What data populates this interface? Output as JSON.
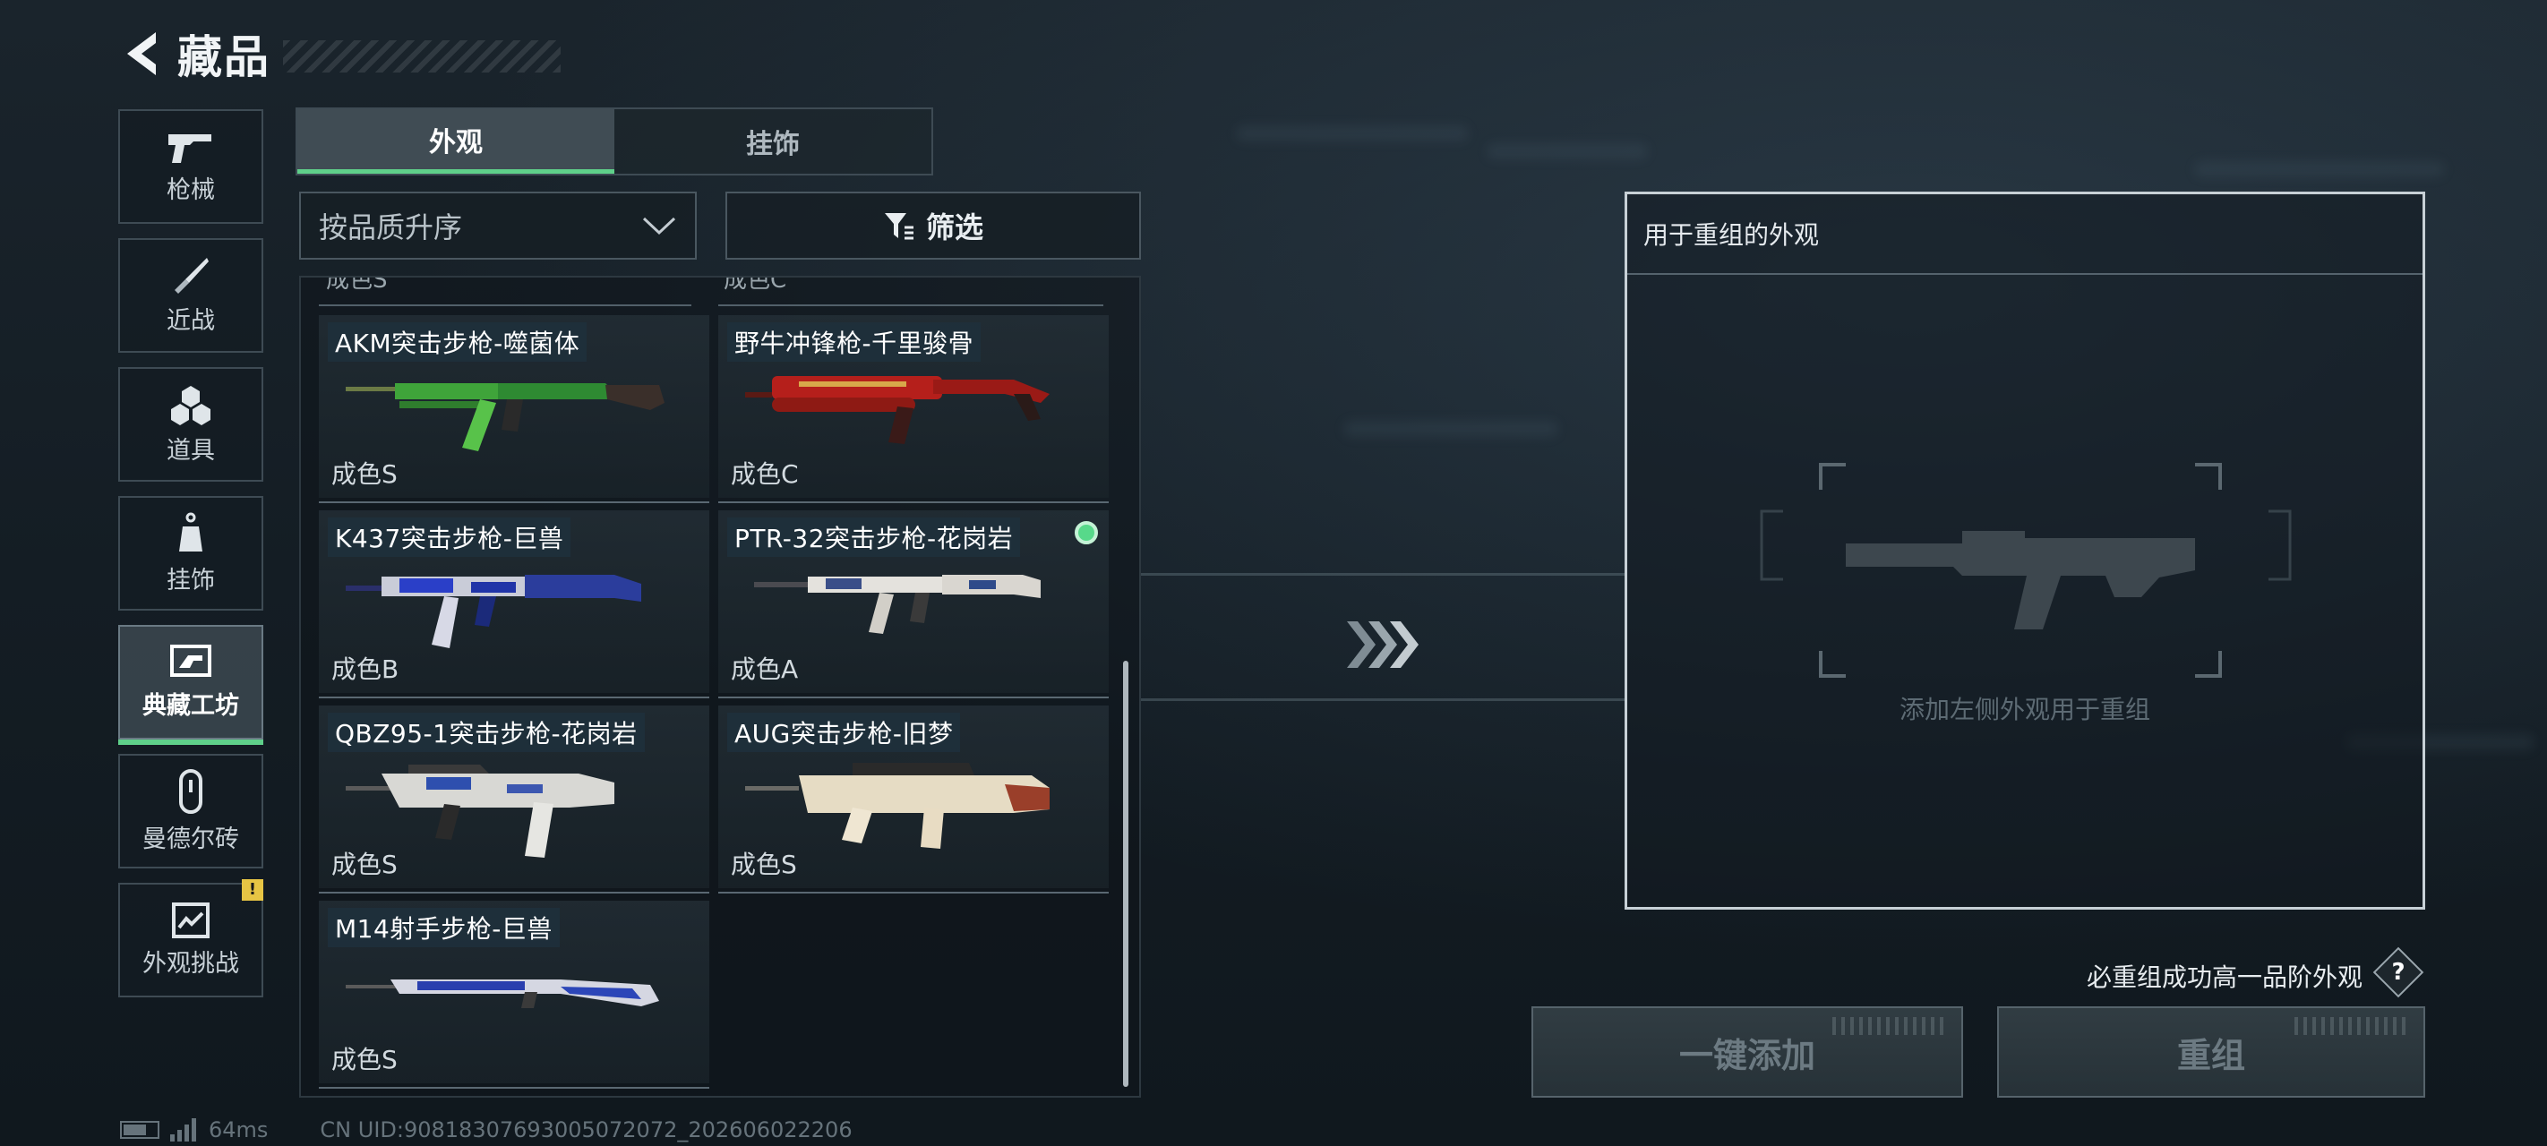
{
  "header": {
    "title": "藏品"
  },
  "sidebar": {
    "items": [
      {
        "label": "枪械",
        "icon": "pistol-icon",
        "active": false
      },
      {
        "label": "近战",
        "icon": "knife-icon",
        "active": false
      },
      {
        "label": "道具",
        "icon": "grenades-icon",
        "active": false
      },
      {
        "label": "挂饰",
        "icon": "charm-icon",
        "active": false
      },
      {
        "label": "典藏工坊",
        "icon": "workshop-icon",
        "active": true
      },
      {
        "label": "曼德尔砖",
        "icon": "mandel-brick-icon",
        "active": false
      },
      {
        "label": "外观挑战",
        "icon": "challenge-icon",
        "active": false,
        "badge": "!"
      }
    ]
  },
  "tabs": [
    {
      "label": "外观",
      "active": true
    },
    {
      "label": "挂饰",
      "active": false
    }
  ],
  "sort": {
    "label": "按品质升序"
  },
  "filter": {
    "label": "筛选"
  },
  "cut_labels": [
    "成色S",
    "成色C"
  ],
  "cards": [
    {
      "name": "AKM突击步枪-噬菌体",
      "grade": "成色S",
      "skin": "green",
      "selected": false
    },
    {
      "name": "野牛冲锋枪-千里骏骨",
      "grade": "成色C",
      "skin": "red",
      "selected": false
    },
    {
      "name": "K437突击步枪-巨兽",
      "grade": "成色B",
      "skin": "blue",
      "selected": false
    },
    {
      "name": "PTR-32突击步枪-花岗岩",
      "grade": "成色A",
      "skin": "granite",
      "selected": true
    },
    {
      "name": "QBZ95-1突击步枪-花岗岩",
      "grade": "成色S",
      "skin": "granite-blue",
      "selected": false
    },
    {
      "name": "AUG突击步枪-旧梦",
      "grade": "成色S",
      "skin": "cream",
      "selected": false
    },
    {
      "name": "M14射手步枪-巨兽",
      "grade": "成色S",
      "skin": "blue",
      "selected": false
    }
  ],
  "recombine": {
    "title": "用于重组的外观",
    "empty_hint": "添加左侧外观用于重组"
  },
  "guarantee_text": "必重组成功高一品阶外观",
  "help_label": "?",
  "buttons": {
    "auto_add": "一键添加",
    "recombine": "重组"
  },
  "status": {
    "ping": "64ms",
    "uid": "CN UID:9081830769300507​2072_202606022206"
  },
  "colors": {
    "accent_green": "#5fd08a",
    "warning_yellow": "#e7c544"
  }
}
